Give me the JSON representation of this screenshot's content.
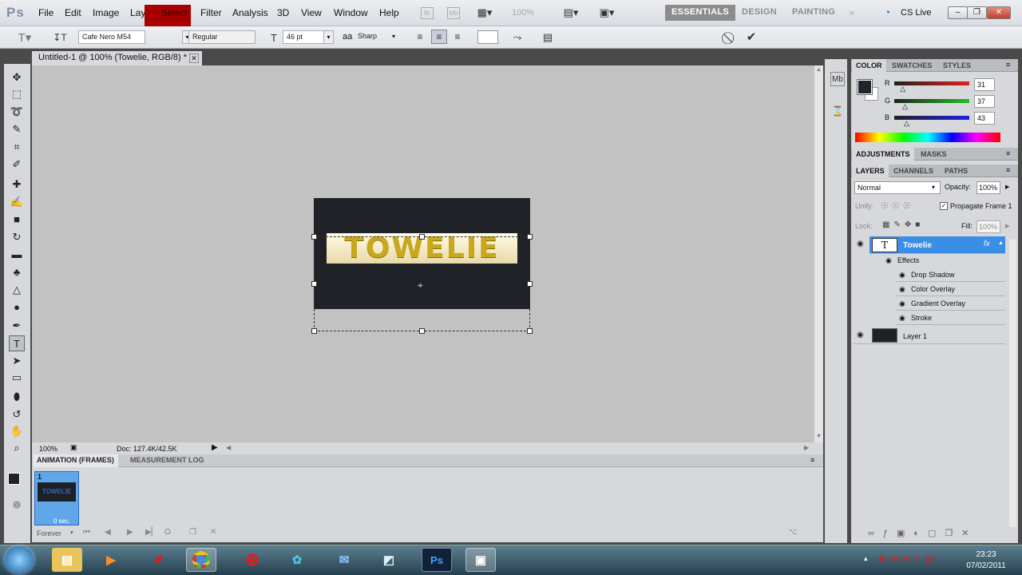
{
  "app": {
    "logo": "Ps",
    "accent": "#a80000"
  },
  "menu": {
    "items": [
      "File",
      "Edit",
      "Image",
      "Layer",
      "Select",
      "Filter",
      "Analysis",
      "3D",
      "View",
      "Window",
      "Help"
    ],
    "zoom": "100%"
  },
  "workspace": {
    "items": [
      "ESSENTIALS",
      "DESIGN",
      "PAINTING"
    ],
    "cslive": "CS Live"
  },
  "options": {
    "font_family": "Cafe Nero M54",
    "font_style": "Regular",
    "font_size": "46 pt",
    "aa_label": "aa",
    "antialias": "Sharp"
  },
  "document": {
    "tab_title": "Untitled-1 @ 100% (Towelie, RGB/8) *",
    "canvas_text": "TOWELIE",
    "canvas_color": "#1f2327"
  },
  "status": {
    "zoom": "100%",
    "doc": "Doc: 127.4K/42.5K"
  },
  "animation": {
    "tabs": [
      "ANIMATION (FRAMES)",
      "MEASUREMENT LOG"
    ],
    "frame_number": "1",
    "frame_text": "TOWELIE",
    "frame_delay": "0 sec.",
    "loop": "Forever"
  },
  "color_panel": {
    "tabs": [
      "COLOR",
      "SWATCHES",
      "STYLES"
    ],
    "r": "31",
    "g": "37",
    "b": "43",
    "r_label": "R",
    "g_label": "G",
    "b_label": "B",
    "r_level": 0.12,
    "g_level": 0.15,
    "b_level": 0.17
  },
  "adjust_tabs": [
    "ADJUSTMENTS",
    "MASKS"
  ],
  "layers_panel": {
    "tabs": [
      "LAYERS",
      "CHANNELS",
      "PATHS"
    ],
    "blend": "Normal",
    "opacity_label": "Opacity:",
    "opacity": "100%",
    "unify": "Unify:",
    "propagate": "Propagate Frame 1",
    "lock": "Lock:",
    "fill_label": "Fill:",
    "fill": "100%",
    "layers": [
      {
        "name": "Towelie"
      },
      {
        "name": "Layer 1"
      }
    ],
    "effects_label": "Effects",
    "effects": [
      "Drop Shadow",
      "Color Overlay",
      "Gradient Overlay",
      "Stroke"
    ],
    "fx": "fx"
  },
  "taskbar": {
    "time": "23:23",
    "date": "07/02/2011",
    "ps": "Ps"
  }
}
